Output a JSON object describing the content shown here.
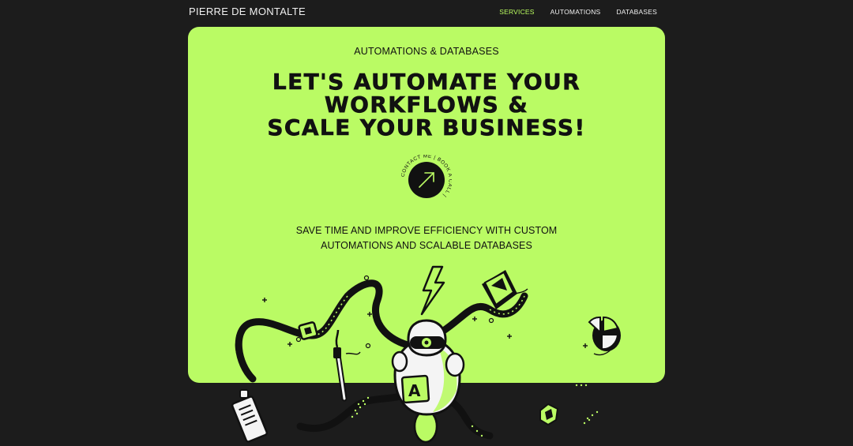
{
  "nav": {
    "brand": "PIERRE DE MONTALTE",
    "links": [
      "SERVICES",
      "AUTOMATIONS",
      "DATABASES"
    ]
  },
  "hero": {
    "eyebrow": "AUTOMATIONS & DATABASES",
    "headline": [
      "LET'S AUTOMATE YOUR",
      "WORKFLOWS &",
      "SCALE YOUR BUSINESS!"
    ],
    "cta_ring_text": "CONTACT ME | BOOK A CALL |",
    "subtitle": [
      "SAVE TIME AND IMPROVE EFFICIENCY WITH CUSTOM",
      "AUTOMATIONS AND SCALABLE DATABASES"
    ],
    "robot_badge": "A"
  },
  "colors": {
    "accent": "#bafb64",
    "background": "#1c1c1c",
    "text_dark": "#111111",
    "nav_active": "#b9fb5f"
  },
  "icons": [
    "arrow-up-right-icon",
    "robot-illustration",
    "lightning-icon",
    "paintbrush-icon",
    "pie-chart-icon",
    "document-icon"
  ]
}
